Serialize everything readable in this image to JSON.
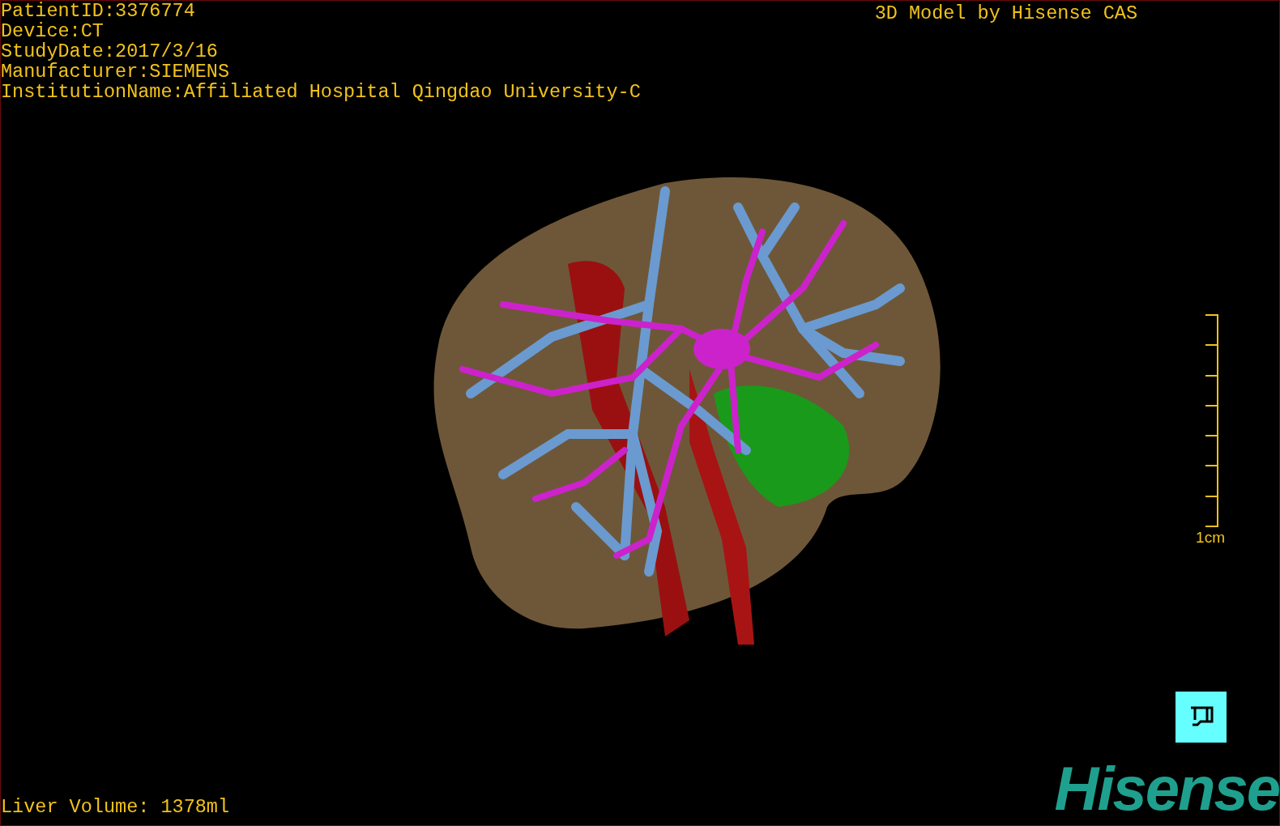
{
  "patient_info": [
    {
      "label": "PatientID:",
      "value": "3376774"
    },
    {
      "label": "Device:",
      "value": "CT"
    },
    {
      "label": "StudyDate:",
      "value": "2017/3/16"
    },
    {
      "label": "Manufacturer:",
      "value": "SIEMENS"
    },
    {
      "label": "InstitutionName:",
      "value": "Affiliated Hospital Qingdao University-C"
    }
  ],
  "viewer_title": "3D Model by Hisense CAS",
  "scale_bar": {
    "label": "1cm"
  },
  "liver_volume": "Liver Volume: 1378ml",
  "logo": "Hisense"
}
